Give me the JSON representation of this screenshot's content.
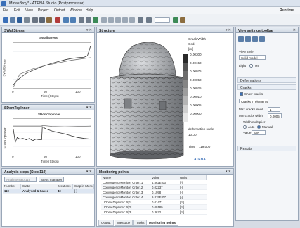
{
  "window": {
    "title": "MidasBrdy* - ATENA Studio [Postprocessor]",
    "brand": "Runtime"
  },
  "menu": [
    "File",
    "Edit",
    "View",
    "Project",
    "Output",
    "Window",
    "Help"
  ],
  "colors": {
    "accent": "#3a6fb8",
    "panel_header": "#cfd7e2",
    "model": "#8f9296"
  },
  "chart_top": {
    "panel_title": "SWallStress",
    "chart_data": {
      "type": "line",
      "title": "SWallStress",
      "xlabel": "Time (Steps)",
      "ylabel": "SWallStress",
      "xlim": [
        0,
        120
      ],
      "x_ticks": [
        "0",
        "50",
        "100"
      ],
      "series": [
        {
          "x": [
            0,
            5,
            20,
            40,
            60,
            80,
            90,
            100,
            110,
            115,
            120
          ],
          "values": [
            0.05,
            0.15,
            0.32,
            0.45,
            0.55,
            0.63,
            0.66,
            0.68,
            0.69,
            0.72,
            0.95
          ]
        },
        {
          "x": [
            0,
            10,
            30,
            50,
            70,
            90,
            110,
            120
          ],
          "values": [
            0.0,
            0.3,
            0.42,
            0.5,
            0.56,
            0.62,
            0.66,
            0.68
          ]
        }
      ]
    }
  },
  "chart_bottom": {
    "panel_title": "SDomTopInner",
    "chart_data": {
      "type": "line",
      "title": "SDomTopInner",
      "xlabel": "Time (Steps)",
      "ylabel": "SDomTopInner",
      "xlim": [
        0,
        120
      ],
      "x_ticks": [
        "0",
        "50",
        "100"
      ],
      "series": [
        {
          "x": [
            0,
            3,
            6,
            10,
            15,
            20,
            25,
            30,
            35,
            40,
            44,
            45,
            50,
            60,
            70,
            80,
            90,
            100,
            110,
            120
          ],
          "values": [
            0.7,
            0.3,
            0.45,
            0.4,
            0.42,
            0.38,
            0.42,
            0.35,
            0.4,
            0.38,
            0.38,
            0.78,
            0.72,
            0.65,
            0.6,
            0.56,
            0.5,
            0.45,
            0.42,
            0.4
          ]
        },
        {
          "x": [
            0,
            20,
            44,
            45,
            60,
            80,
            100,
            120
          ],
          "values": [
            0.8,
            0.8,
            0.8,
            0.82,
            0.79,
            0.78,
            0.79,
            0.8
          ]
        }
      ]
    }
  },
  "structure": {
    "panel_title": "Structure",
    "legend_title": "Crack Width",
    "legend_sub": "Cod.",
    "legend_unit": "[m]",
    "legend_values": [
      "0.00300",
      "0.00150",
      "0.00075",
      "0.00050",
      "0.00025",
      "0.00010",
      "0.00005",
      "0.00000"
    ],
    "legend_colors": [
      "#2a2a2a",
      "#555",
      "#6d6d6d",
      "#858585",
      "#9d9d9d",
      "#b5b5b5",
      "#cfcfcf",
      "#e6e6e6"
    ],
    "scale_label": "deformation scale",
    "scale_value": "10.00",
    "time_label": "Time",
    "time_value": "119.000",
    "brand": "ATENA"
  },
  "analysis": {
    "panel_title": "Analysis steps (Step 119)",
    "btn_analyse": "Analyse step 119",
    "btn_steps": "Steps manager",
    "headers": [
      "Number",
      "State",
      "Iterations",
      "Step in Memory"
    ],
    "rows": [
      {
        "number": "119",
        "state": "Analysed & Saved",
        "iterations": "40",
        "memory": "[ ]"
      }
    ]
  },
  "monitoring": {
    "panel_title": "Monitoring points",
    "headers": [
      "Name",
      "Value",
      "Units"
    ],
    "rows": [
      {
        "name": "ConvergenceMonitor: Criter. 1",
        "value": "4.862E-03",
        "units": "[-]"
      },
      {
        "name": "ConvergenceMonitor: Criter. 2",
        "value": "0.02237",
        "units": "[-]"
      },
      {
        "name": "ConvergenceMonitor: Criter. 3",
        "value": "0.1998",
        "units": "[-]"
      },
      {
        "name": "ConvergenceMonitor: Criter. 4",
        "value": "9.815E-07",
        "units": "[-]"
      },
      {
        "name": "UDomeTopInner: X[1]",
        "value": "0.01471",
        "units": "[m]"
      },
      {
        "name": "UDomeTopInner: X[2]",
        "value": "0.00189",
        "units": "[m]"
      },
      {
        "name": "UDomeTopInner: X[3]",
        "value": "0.3622",
        "units": "[m]"
      }
    ]
  },
  "bottom_tabs": [
    "Output",
    "Message",
    "Tasks",
    "Monitoring points"
  ],
  "settings": {
    "panel_title": "View settings toolbar",
    "view_style_label": "View style",
    "view_style_value": "Solid model",
    "light_label": "Light",
    "light_value": "on",
    "sec_deformations": "Deformations",
    "sec_cracks": "Cracks",
    "show_cracks": "Show cracks",
    "cracks_in": "Cracks in elements",
    "max_level_label": "Max cracks level",
    "max_level_value": "1",
    "min_width_label": "Min cracks width",
    "min_width_value": "0.0005",
    "width_mult_label": "Width multiplier",
    "auto_label": "Auto",
    "manual_label": "Manual",
    "value_label": "Value",
    "value_value": "500",
    "sec_results": "Results"
  }
}
